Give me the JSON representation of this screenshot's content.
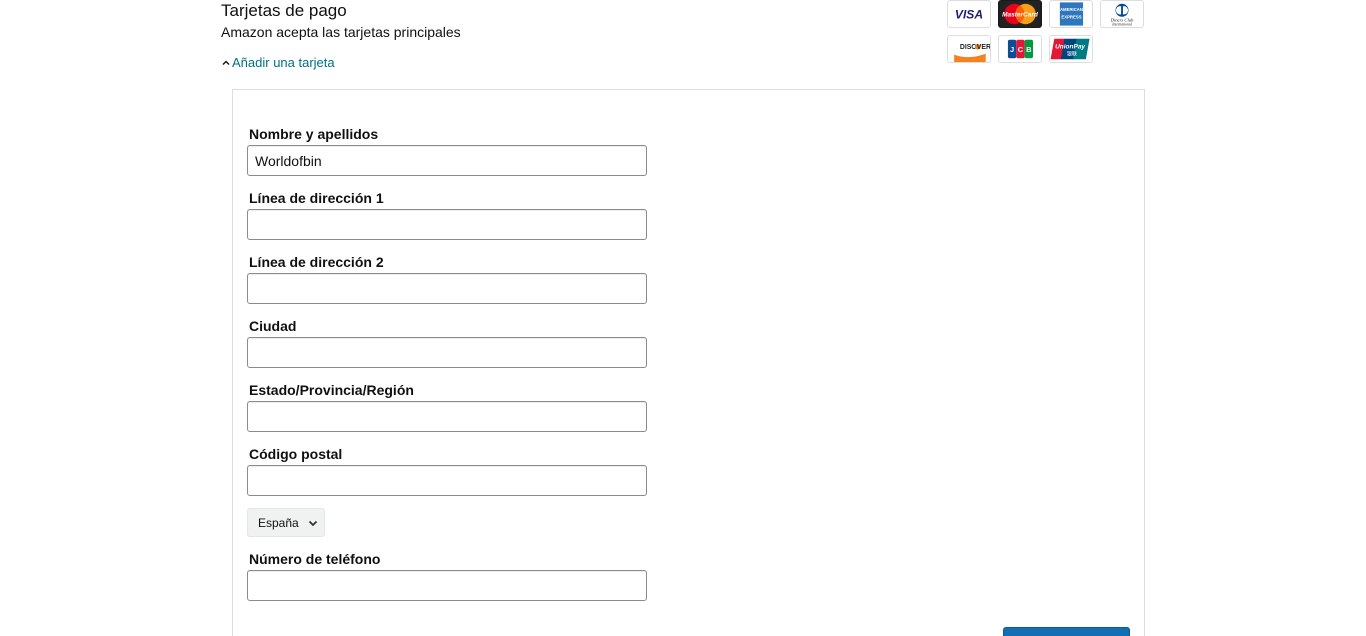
{
  "header": {
    "title": "Tarjetas de pago",
    "subtitle": "Amazon acepta las tarjetas principales",
    "add_card_link": "Añadir una tarjeta"
  },
  "card_logos": [
    {
      "name": "visa-logo",
      "label": "VISA"
    },
    {
      "name": "mastercard-logo",
      "label": "MasterCard"
    },
    {
      "name": "amex-logo",
      "label": "AMERICAN EXPRESS"
    },
    {
      "name": "diners-club-logo",
      "label": "Diners Club International"
    },
    {
      "name": "discover-logo",
      "label": "DISCOVER"
    },
    {
      "name": "jcb-logo",
      "label": "JCB"
    },
    {
      "name": "unionpay-logo",
      "label": "UnionPay 银联"
    }
  ],
  "form": {
    "full_name": {
      "label": "Nombre y apellidos",
      "value": "Worldofbin"
    },
    "address_line_1": {
      "label": "Línea de dirección 1",
      "value": ""
    },
    "address_line_2": {
      "label": "Línea de dirección 2",
      "value": ""
    },
    "city": {
      "label": "Ciudad",
      "value": ""
    },
    "state": {
      "label": "Estado/Provincia/Región",
      "value": ""
    },
    "postal_code": {
      "label": "Código postal",
      "value": ""
    },
    "country": {
      "selected": "España"
    },
    "phone": {
      "label": "Número de teléfono",
      "value": ""
    }
  },
  "colors": {
    "link": "#007185",
    "primary_button": "#146eb4",
    "input_border": "#888c8c",
    "panel_border": "#dddddd"
  }
}
